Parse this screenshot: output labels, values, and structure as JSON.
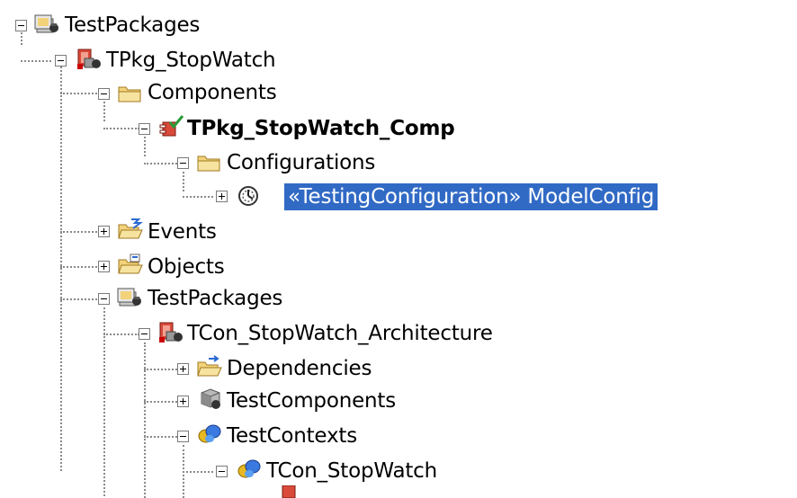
{
  "tree": {
    "nodes": [
      {
        "label": "TestPackages",
        "icon": "test-packages-icon",
        "expander": "collapse"
      },
      {
        "label": "TPkg_StopWatch",
        "icon": "test-package-icon",
        "expander": "collapse"
      },
      {
        "label": "Components",
        "icon": "folder-icon",
        "expander": "collapse"
      },
      {
        "label": "TPkg_StopWatch_Comp",
        "icon": "component-check-icon",
        "expander": "collapse"
      },
      {
        "label": "Configurations",
        "icon": "folder-icon",
        "expander": "collapse"
      },
      {
        "label": "«TestingConfiguration» ModelConfig",
        "icon": "configuration-icon",
        "expander": "expand",
        "selected": true
      },
      {
        "label": "Events",
        "icon": "events-folder-icon",
        "expander": "expand"
      },
      {
        "label": "Objects",
        "icon": "objects-folder-icon",
        "expander": "expand"
      },
      {
        "label": "TestPackages",
        "icon": "test-packages-icon",
        "expander": "collapse"
      },
      {
        "label": "TCon_StopWatch_Architecture",
        "icon": "test-package-icon",
        "expander": "collapse"
      },
      {
        "label": "Dependencies",
        "icon": "dependencies-folder-icon",
        "expander": "expand"
      },
      {
        "label": "TestComponents",
        "icon": "test-components-icon",
        "expander": "expand"
      },
      {
        "label": "TestContexts",
        "icon": "test-contexts-icon",
        "expander": "collapse"
      },
      {
        "label": "TCon_StopWatch",
        "icon": "test-context-icon",
        "expander": "collapse"
      }
    ]
  },
  "colors": {
    "selection": "#316ac5",
    "folder": "#f2d27a",
    "tree_line": "#8a8a8a"
  }
}
